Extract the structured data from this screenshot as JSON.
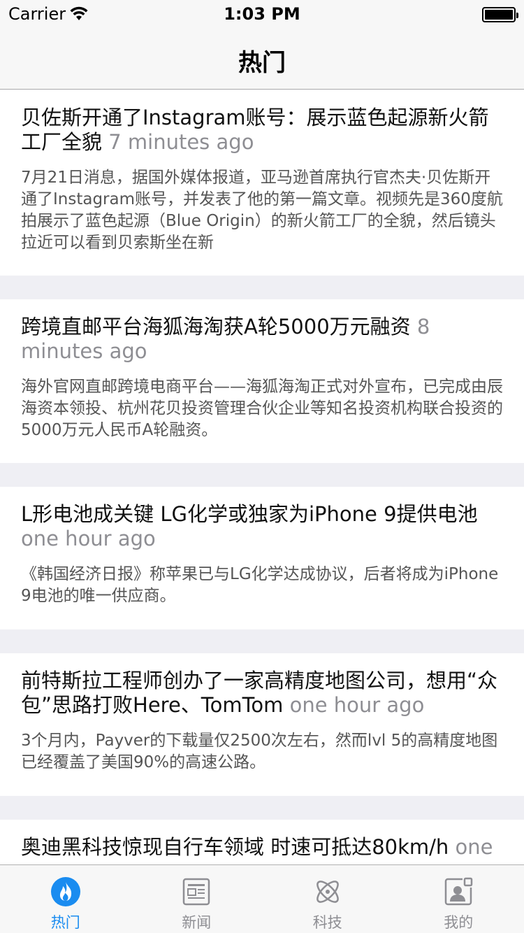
{
  "status_bar": {
    "carrier": "Carrier",
    "time": "1:03 PM"
  },
  "nav": {
    "title": "热门"
  },
  "feed": [
    {
      "title": "贝佐斯开通了Instagram账号：展示蓝色起源新火箭工厂全貌",
      "time": "7 minutes ago",
      "summary": "7月21日消息，据国外媒体报道，亚马逊首席执行官杰夫·贝佐斯开通了Instagram账号，并发表了他的第一篇文章。视频先是360度航拍展示了蓝色起源（Blue Origin）的新火箭工厂的全貌，然后镜头拉近可以看到贝索斯坐在新"
    },
    {
      "title": "跨境直邮平台海狐海淘获A轮5000万元融资",
      "time": "8 minutes ago",
      "summary": "海外官网直邮跨境电商平台——海狐海淘正式对外宣布，已完成由辰海资本领投、杭州花贝投资管理合伙企业等知名投资机构联合投资的5000万元人民币A轮融资。"
    },
    {
      "title": "L形电池成关键 LG化学或独家为iPhone 9提供电池",
      "time": "one hour ago",
      "summary": "《韩国经济日报》称苹果已与LG化学达成协议，后者将成为iPhone 9电池的唯一供应商。"
    },
    {
      "title": "前特斯拉工程师创办了一家高精度地图公司，想用“众包”思路打败Here、TomTom",
      "time": "one hour ago",
      "summary": "3个月内，Payver的下载量仅2500次左右，然而lvl 5的高精度地图已经覆盖了美国90%的高速公路。"
    },
    {
      "title": "奥迪黑科技惊现自行车领域 时速可抵达80km/h",
      "time": "one",
      "summary": ""
    }
  ],
  "tabbar": {
    "tabs": [
      {
        "label": "热门",
        "icon": "flame-icon",
        "active": true
      },
      {
        "label": "新闻",
        "icon": "newspaper-icon",
        "active": false
      },
      {
        "label": "科技",
        "icon": "atom-icon",
        "active": false
      },
      {
        "label": "我的",
        "icon": "profile-card-icon",
        "active": false
      }
    ],
    "active_color": "#1a8cf0",
    "inactive_color": "#8e8e93"
  }
}
